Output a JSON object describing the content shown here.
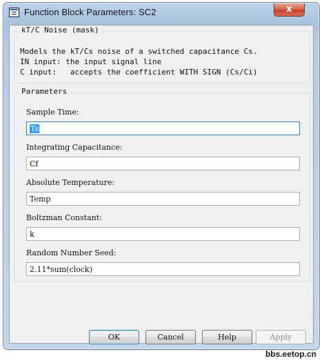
{
  "window": {
    "title": "Function Block Parameters: SC2",
    "close_glyph": "x"
  },
  "mask": {
    "legend": "kT/C Noise (mask)",
    "description_lines": [
      "Models the kT/Cs noise of a switched capacitance Cs.",
      "IN input: the input signal line",
      "C input:   accepts the coefficient WITH SIGN (Cs/Ci)"
    ]
  },
  "parameters": {
    "legend": "Parameters",
    "fields": [
      {
        "label": "Sample Time:",
        "value": "Ts"
      },
      {
        "label": "Integrating Capacitance:",
        "value": "Cf"
      },
      {
        "label": "Absolute Temperature:",
        "value": "Temp"
      },
      {
        "label": "Boltzman Constant:",
        "value": "k"
      },
      {
        "label": "Random Number Seed:",
        "value": "2.11*sum(clock)"
      }
    ]
  },
  "buttons": {
    "ok": "OK",
    "cancel": "Cancel",
    "help": "Help",
    "apply": "Apply"
  },
  "watermark": "bbs.eetop.cn",
  "colors": {
    "frame": "#b6cce3",
    "client": "#f0f0f0",
    "selection": "#3399ff",
    "close_button": "#c2402a"
  }
}
